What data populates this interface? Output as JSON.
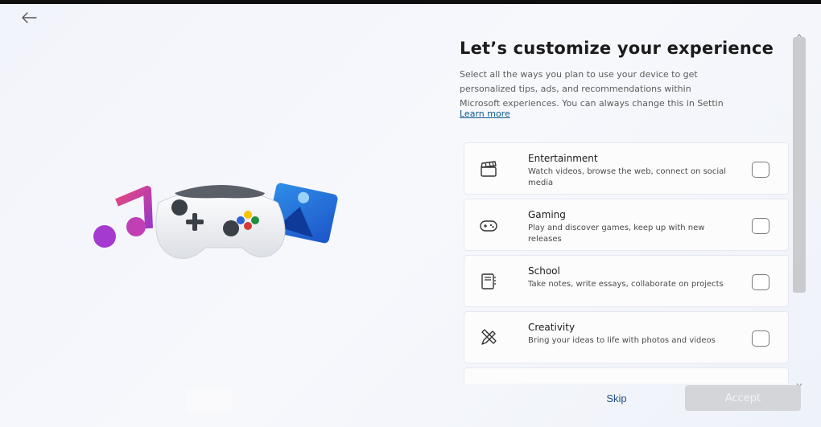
{
  "header": {
    "back_icon": "arrow-left-icon"
  },
  "panel": {
    "title": "Let’s customize your experience",
    "description_lines": [
      "Select all the ways you plan to use your device to get",
      "personalized tips, ads, and recommendations within",
      "Microsoft experiences. You can always change this in Settin"
    ],
    "learn_more": "Learn more",
    "options": [
      {
        "title": "Entertainment",
        "desc": "Watch videos, browse the web, connect on social media",
        "icon": "clapperboard-icon",
        "checked": false
      },
      {
        "title": "Gaming",
        "desc": "Play and discover games, keep up with new releases",
        "icon": "gamepad-icon",
        "checked": false
      },
      {
        "title": "School",
        "desc": "Take notes, write essays, collaborate on projects",
        "icon": "notebook-icon",
        "checked": false
      },
      {
        "title": "Creativity",
        "desc": "Bring your ideas to life with photos and videos",
        "icon": "pencil-ruler-icon",
        "checked": false
      }
    ]
  },
  "footer": {
    "skip_label": "Skip",
    "accept_label": "Accept"
  },
  "hero_icons": [
    "music-note-icon",
    "game-controller-icon",
    "photos-icon"
  ],
  "colors": {
    "accent_link": "#0a5a93",
    "skip_text": "#1f4e8c",
    "accept_disabled_bg": "#d3d5d9"
  }
}
